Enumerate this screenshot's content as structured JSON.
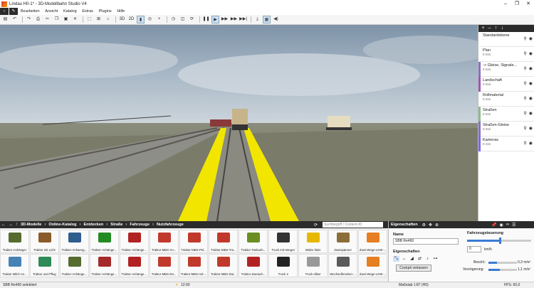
{
  "window": {
    "title": "Lindau H0-1* - 3D-Modellbahn Studio V4",
    "min": "–",
    "max": "❐",
    "close": "✕"
  },
  "menu": {
    "back": "‹",
    "edit": "✎",
    "items": [
      "Bearbeiten",
      "Ansicht",
      "Katalog",
      "Extras",
      "Plugins",
      "Hilfe"
    ]
  },
  "toolbar": {
    "view3d": "3D",
    "view2d": "2D",
    "pause": "❚❚",
    "play": "▶",
    "ff1": "▶▶",
    "ff2": "▶▶",
    "ff3": "▶▶|"
  },
  "layers": {
    "head_add": "+",
    "head_remove": "–",
    "head_up": "↑",
    "head_down": "↓",
    "items": [
      {
        "name": "Standardebene",
        "sub": "-",
        "color": "#ffffff"
      },
      {
        "name": "Plan",
        "sub": "0 mm",
        "color": "#ffffff"
      },
      {
        "name": "-> Gleise, Signale...",
        "sub": "0 mm",
        "color": "#8a6fc4"
      },
      {
        "name": "Landschaft",
        "sub": "0 mm",
        "color": "#9b59b6"
      },
      {
        "name": "Rollmaterial",
        "sub": "0 mm",
        "color": "#ffffff"
      },
      {
        "name": "Straßen",
        "sub": "0 mm",
        "color": "#8fbc8f"
      },
      {
        "name": "Straßen-Gleise",
        "sub": "0 mm",
        "color": "#8a6fc4"
      },
      {
        "name": "Kameras",
        "sub": "0 mm",
        "color": "#7b68ee"
      }
    ]
  },
  "catalog": {
    "breadcrumb": [
      "3D-Modelle",
      "Online-Katalog",
      "Entdecken",
      "Straße",
      "Fahrzeuge",
      "Nutzfahrzeuge"
    ],
    "search_placeholder": "Suchbegriff / Content-ID",
    "row1": [
      {
        "label": "Traktor-Anhänger",
        "color": "#556b2f"
      },
      {
        "label": "Traktor mit Licht",
        "color": "#8b5a2b"
      },
      {
        "label": "Traktor-Anhaeng...",
        "color": "#2e5e8e"
      },
      {
        "label": "Traktor-Anhänge...",
        "color": "#228b22"
      },
      {
        "label": "Traktor-Anhänge...",
        "color": "#b22222"
      },
      {
        "label": "Traktor-MBS-An...",
        "color": "#c0392b"
      },
      {
        "label": "Traktor-MBS-Pel...",
        "color": "#c0392b"
      },
      {
        "label": "Traktor-MBS-Tra...",
        "color": "#c0392b"
      },
      {
        "label": "Traktor-Tankanh...",
        "color": "#6b8e23"
      },
      {
        "label": "Truck mit Hänger",
        "color": "#333333"
      },
      {
        "label": "Walze klein",
        "color": "#e6b800"
      },
      {
        "label": "Zweispänner",
        "color": "#8b6d3a"
      },
      {
        "label": "Zwei-Wege-LKW-...",
        "color": "#e67e22"
      }
    ],
    "row2": [
      {
        "label": "Traktor Milch An...",
        "color": "#4682b4"
      },
      {
        "label": "Traktor und Pflug",
        "color": "#2e8b57"
      },
      {
        "label": "Traktor-Anhänge...",
        "color": "#556b2f"
      },
      {
        "label": "Traktor-Anhänge...",
        "color": "#a52a2a"
      },
      {
        "label": "Traktor-Anhänge...",
        "color": "#b22222"
      },
      {
        "label": "Traktor-MBS-Dü...",
        "color": "#c0392b"
      },
      {
        "label": "Traktor-MBS-mit-...",
        "color": "#c0392b"
      },
      {
        "label": "Traktor-MBS-Zwi...",
        "color": "#c0392b"
      },
      {
        "label": "Traktor-Zweiach...",
        "color": "#b22222"
      },
      {
        "label": "Truck 2",
        "color": "#222222"
      },
      {
        "label": "Truck silber",
        "color": "#999999"
      },
      {
        "label": "Wechselbrücken-...",
        "color": "#5a5a5a"
      },
      {
        "label": "Zwei-Wege-LKW-...",
        "color": "#e67e22"
      }
    ]
  },
  "properties": {
    "tab": "Eigenschaften",
    "name_label": "Name",
    "name_value": "SBB Re460",
    "props_label": "Eigenschaften",
    "cockpit": "Cockpit verlassen",
    "control_label": "Fahrzeugsteuerung",
    "speed_value": "0",
    "speed_unit": "km/h",
    "accel_label": "Beschl.:",
    "accel_value": "0,3 m/s²",
    "decel_label": "Verzögerung:",
    "decel_value": "1,1 m/s²"
  },
  "status": {
    "selected": "SBB Re460 selektiert",
    "time": "12:00",
    "scale": "Maßstab 1:87 (H0)",
    "fps": "FPS: 60,0"
  }
}
